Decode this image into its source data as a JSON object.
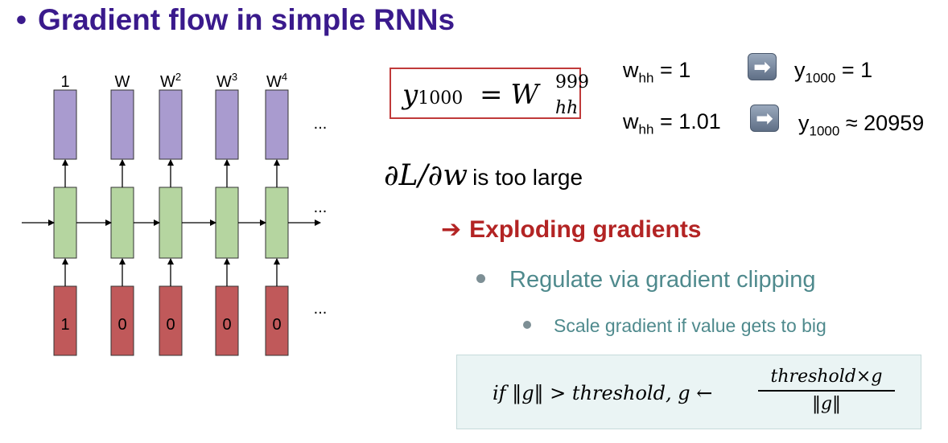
{
  "title": {
    "bullet": "•",
    "text": "Gradient flow in simple RNNs"
  },
  "diagram": {
    "top_labels": [
      "1",
      "W",
      "W",
      "W",
      "W"
    ],
    "top_label_sups": [
      "",
      "",
      "2",
      "3",
      "4"
    ],
    "inputs": [
      "1",
      "0",
      "0",
      "0",
      "0"
    ],
    "ellipsis": "...",
    "colors": {
      "output": "#a99bcf",
      "hidden": "#b5d5a0",
      "input": "#c0595a"
    }
  },
  "formula": {
    "lhs": "y",
    "lhs_sub": "1000",
    "eq": "=",
    "rhs": "W",
    "rhs_sup": "999",
    "rhs_sub": "hh"
  },
  "examples": [
    {
      "w_prefix": "w",
      "w_sub": "hh",
      "w_value": "= 1",
      "y_prefix": "y",
      "y_sub": "1000",
      "y_value": "= 1"
    },
    {
      "w_prefix": "w",
      "w_sub": "hh",
      "w_value": "= 1.01",
      "y_prefix": "y",
      "y_sub": "1000",
      "y_value": "≈ 20959"
    }
  ],
  "arrow_icon": "➡",
  "gradient": {
    "expr": "∂L/∂w",
    "text": "is too large"
  },
  "exploding": {
    "arrow": "➔",
    "text": "Exploding gradients"
  },
  "regulate": "Regulate via gradient clipping",
  "scale": "Scale gradient if value gets to big",
  "clip": {
    "lhs": "if ‖g‖ > threshold, g ←",
    "numerator": "threshold×g",
    "denominator": "‖g‖"
  }
}
